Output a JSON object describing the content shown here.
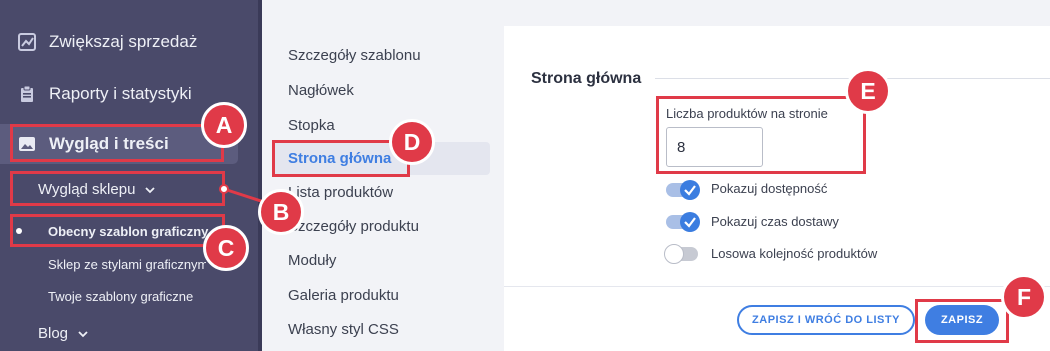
{
  "sidebar": {
    "nav": [
      {
        "label": "Zwiększaj sprzedaż",
        "icon": "trend-chart-icon"
      },
      {
        "label": "Raporty i statystyki",
        "icon": "clipboard-icon"
      },
      {
        "label": "Wygląd i treści",
        "icon": "image-icon"
      }
    ],
    "submenu": {
      "label": "Wygląd sklepu",
      "icon": "chevron-down-icon",
      "items": [
        "Obecny szablon graficzny",
        "Sklep ze stylami graficznymi",
        "Twoje szablony graficzne"
      ]
    },
    "blog": {
      "label": "Blog",
      "icon": "chevron-down-icon"
    }
  },
  "menu": {
    "items": [
      "Szczegóły szablonu",
      "Nagłówek",
      "Stopka",
      "Strona główna",
      "Lista produktów",
      "Szczegóły produktu",
      "Moduły",
      "Galeria produktu",
      "Własny styl CSS"
    ],
    "active_index": 3
  },
  "content": {
    "section_title": "Strona główna",
    "field": {
      "label": "Liczba produktów na stronie",
      "value": "8"
    },
    "toggles": [
      {
        "label": "Pokazuj dostępność",
        "on": true
      },
      {
        "label": "Pokazuj czas dostawy",
        "on": true
      },
      {
        "label": "Losowa kolejność produktów",
        "on": false
      }
    ],
    "buttons": {
      "save_return": "ZAPISZ I WRÓĆ DO LISTY",
      "save": "ZAPISZ"
    }
  },
  "annotations": [
    "A",
    "B",
    "C",
    "D",
    "E",
    "F"
  ],
  "colors": {
    "accent": "#3f7ee2",
    "annotation": "#e03a48",
    "sidebar": "#4a4a6a"
  }
}
